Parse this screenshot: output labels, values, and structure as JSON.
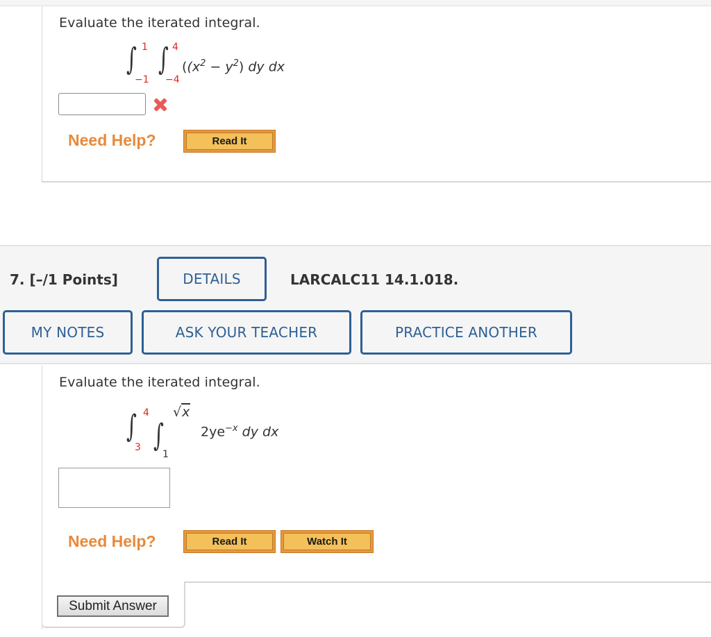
{
  "previous_question": {
    "prompt": "Evaluate the iterated integral.",
    "integral": {
      "outer_lower": "−1",
      "outer_upper": "1",
      "inner_lower": "−4",
      "inner_upper": "4",
      "integrand_open": "(x",
      "exp1": "2",
      "minus": " − y",
      "exp2": "2",
      "close": ")",
      "differentials": " dy dx"
    },
    "answer_value": "",
    "answer_status": "incorrect",
    "answer_status_icon": "x-mark-icon",
    "need_help_label": "Need Help?",
    "help_buttons": [
      "Read It"
    ]
  },
  "question": {
    "number_label": "7.  [–/1 Points]",
    "details_label": "DETAILS",
    "code": "LARCALC11 14.1.018.",
    "actions": [
      "MY NOTES",
      "ASK YOUR TEACHER",
      "PRACTICE ANOTHER"
    ],
    "prompt": "Evaluate the iterated integral.",
    "integral": {
      "outer_lower": "3",
      "outer_upper": "4",
      "inner_lower": "1",
      "inner_upper_radical": "√",
      "inner_upper_radicand": "x",
      "integrand_coef": "2ye",
      "integrand_exp": "−x",
      "differentials": " dy dx"
    },
    "answer_value": "",
    "need_help_label": "Need Help?",
    "help_buttons": [
      "Read It",
      "Watch It"
    ],
    "submit_label": "Submit Answer"
  },
  "colors": {
    "accent_blue": "#2e6094",
    "limit_red": "#e8231c",
    "need_help_orange": "#e8893a",
    "help_button_fill": "#f3c05a",
    "incorrect_red": "#e85a5a"
  }
}
